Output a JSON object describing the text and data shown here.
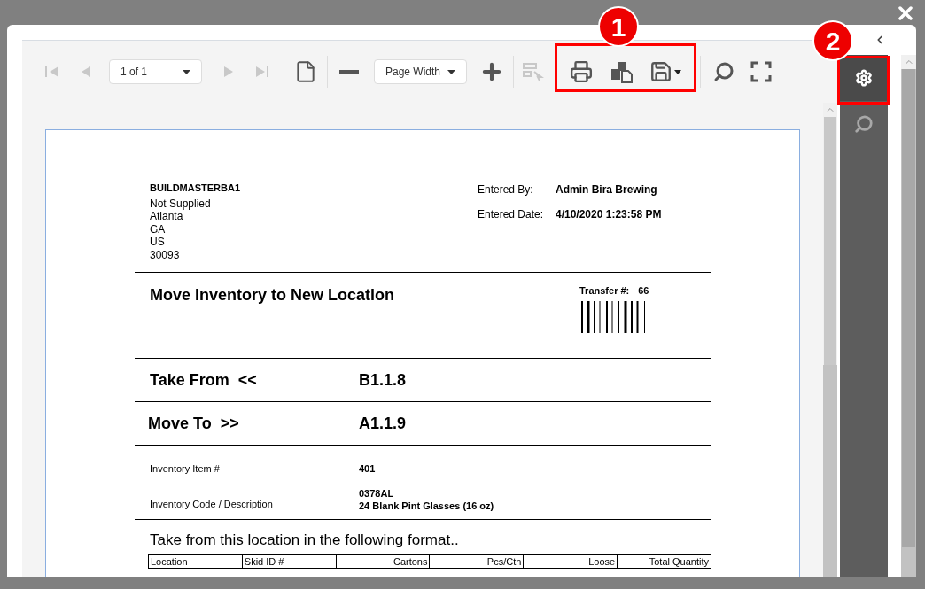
{
  "toolbar": {
    "first_page": {
      "disabled": true
    },
    "previous_page": {
      "disabled": true
    },
    "page_selector": {
      "value": "1 of 1"
    },
    "next_page": {
      "disabled": true
    },
    "last_page": {
      "disabled": true
    },
    "selection_tool": {
      "disabled": true
    },
    "zoom_selector": {
      "value": "Page Width"
    }
  },
  "sidebar": {
    "tabs": [
      {
        "selected": true
      },
      {
        "selected": false
      }
    ]
  },
  "annotations": [
    {
      "label": "1"
    },
    {
      "label": "2"
    }
  ],
  "document": {
    "company": {
      "name": "BUILDMASTERBA1",
      "address_lines": [
        "Not Supplied",
        "Atlanta",
        "GA",
        "US",
        "30093"
      ]
    },
    "meta": [
      {
        "label": "Entered By:",
        "value": "Admin Bira Brewing"
      },
      {
        "label": "Entered Date:",
        "value": "4/10/2020 1:23:58 PM"
      }
    ],
    "title": "Move Inventory to New Location",
    "transfer": {
      "label": "Transfer #:",
      "value": "66"
    },
    "take_from": {
      "label": "Take From  <<",
      "value": "B1.1.8"
    },
    "move_to": {
      "label": "Move To  >>",
      "value": "A1.1.9"
    },
    "item": {
      "label": "Inventory Item #",
      "value": "401"
    },
    "code": {
      "label": "Inventory Code / Description",
      "lines": [
        "0378AL",
        "24 Blank Pint Glasses (16 oz)"
      ]
    },
    "instruction": "Take from this location in the following format..",
    "table": {
      "columns": [
        {
          "label": "Location"
        },
        {
          "label": "Skid ID #"
        },
        {
          "label": "Cartons"
        },
        {
          "label": "Pcs/Ctn"
        },
        {
          "label": "Loose"
        },
        {
          "label": "Total Quantity"
        }
      ]
    }
  }
}
